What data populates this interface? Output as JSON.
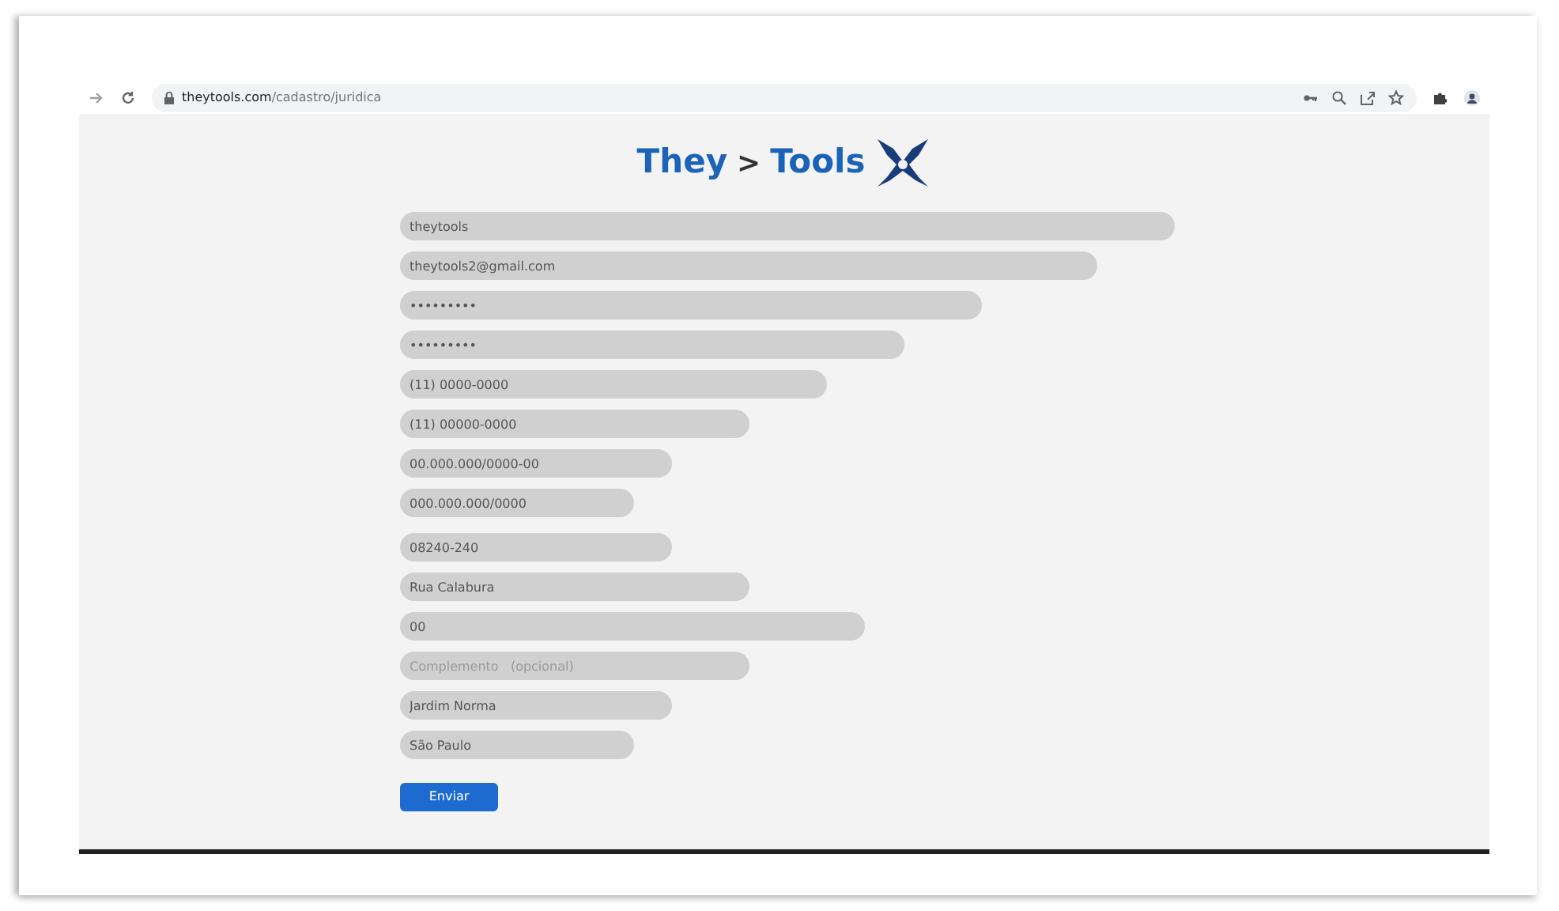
{
  "browser": {
    "url_host": "theytools.com",
    "url_path": "/cadastro/juridica"
  },
  "logo": {
    "left": "They",
    "separator": ">",
    "right": "Tools"
  },
  "fields": [
    {
      "kind": "text",
      "value": "theytools"
    },
    {
      "kind": "text",
      "value": "theytools2@gmail.com"
    },
    {
      "kind": "text",
      "value": "•••••••••"
    },
    {
      "kind": "text",
      "value": "•••••••••"
    },
    {
      "kind": "text",
      "value": "(11) 0000-0000"
    },
    {
      "kind": "text",
      "value": "(11) 00000-0000"
    },
    {
      "kind": "text",
      "value": "00.000.000/0000-00"
    },
    {
      "kind": "text",
      "value": "000.000.000/0000"
    },
    {
      "kind": "text",
      "value": "08240-240"
    },
    {
      "kind": "text",
      "value": "Rua Calabura"
    },
    {
      "kind": "text",
      "value": "00"
    },
    {
      "kind": "empty",
      "placeholder": "Complemento   (opcional)"
    },
    {
      "kind": "text",
      "value": "Jardim Norma"
    },
    {
      "kind": "text",
      "value": "São Paulo"
    }
  ],
  "submit": "Enviar"
}
